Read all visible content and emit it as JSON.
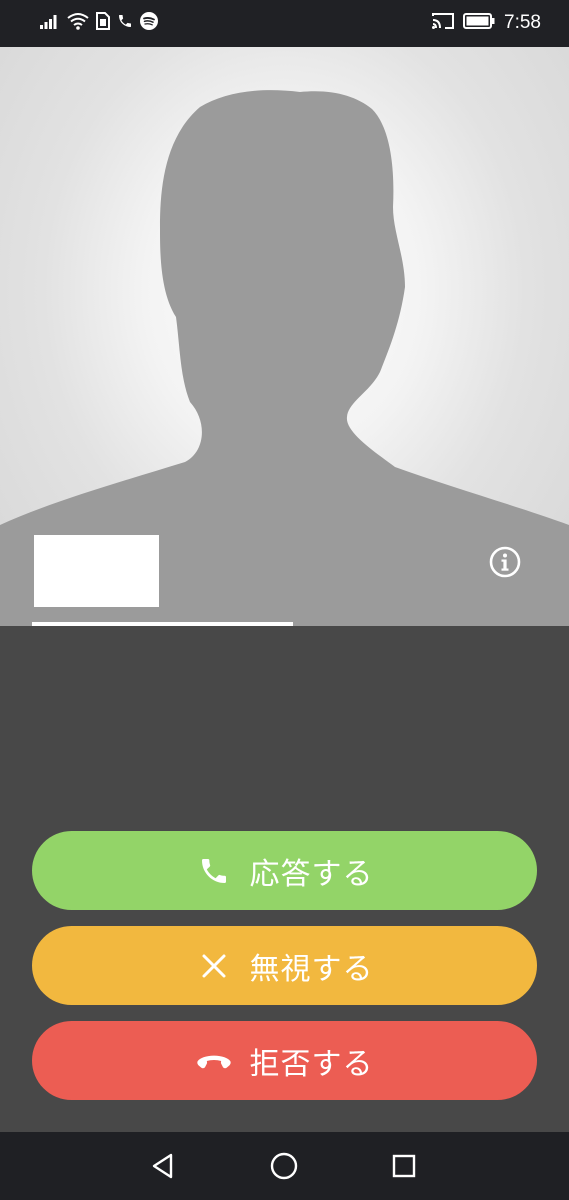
{
  "status_bar": {
    "time": "7:58",
    "icons": [
      "signal-icon",
      "wifi-icon",
      "sim-icon",
      "phone-icon",
      "spotify-icon",
      "cast-icon",
      "battery-icon"
    ]
  },
  "caller": {
    "name": "",
    "number": ""
  },
  "actions": {
    "answer_label": "応答する",
    "ignore_label": "無視する",
    "decline_label": "拒否する"
  },
  "colors": {
    "answer": "#93d468",
    "ignore": "#f2b83f",
    "decline": "#ec5d53",
    "background": "#484848"
  },
  "nav": {
    "icons": [
      "back-icon",
      "home-icon",
      "recents-icon"
    ]
  }
}
